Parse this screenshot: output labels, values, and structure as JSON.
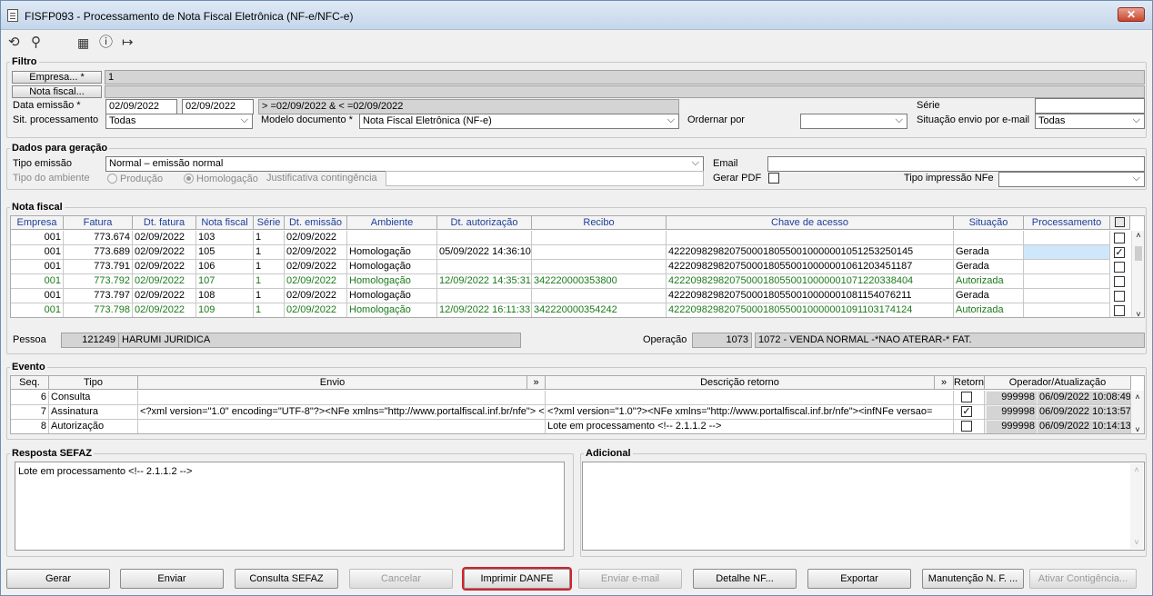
{
  "window": {
    "title": "FISFP093 - Processamento de Nota Fiscal Eletrônica (NF-e/NFC-e)",
    "close": "✕"
  },
  "toolbar": {
    "undo_icon": "undo-icon",
    "search_icon": "search-icon",
    "calendar_icon": "calendar-icon",
    "help_icon": "help-icon",
    "exit_icon": "exit-icon"
  },
  "filtro": {
    "title": "Filtro",
    "empresa_btn": "Empresa... *",
    "empresa_val": "1",
    "nota_btn": "Nota fiscal...",
    "data_lbl": "Data emissão *",
    "data_from": "02/09/2022",
    "data_to": "02/09/2022",
    "data_expr": "> =02/09/2022 & < =02/09/2022",
    "serie_lbl": "Série",
    "serie_val": "",
    "sit_lbl": "Sit. processamento",
    "sit_val": "Todas",
    "modelo_lbl": "Modelo documento *",
    "modelo_val": "Nota Fiscal Eletrônica (NF-e)",
    "ordenar_lbl": "Ordernar por",
    "ordenar_val": "",
    "situacao_email_lbl": "Situação envio por e-mail",
    "situacao_email_val": "Todas"
  },
  "dados": {
    "title": "Dados para geração",
    "tipo_emissao_lbl": "Tipo emissão",
    "tipo_emissao_val": "Normal – emissão normal",
    "email_lbl": "Email",
    "email_val": "",
    "tipo_ambiente_lbl": "Tipo do ambiente",
    "producao": "Produção",
    "homologacao": "Homologação",
    "justificativa_lbl": "Justificativa contingência",
    "justificativa_val": "",
    "gerar_pdf_lbl": "Gerar PDF",
    "tipo_impressao_lbl": "Tipo impressão NFe",
    "tipo_impressao_val": ""
  },
  "nota": {
    "title": "Nota fiscal",
    "headers": [
      "Empresa",
      "Fatura",
      "Dt. fatura",
      "Nota fiscal",
      "Série",
      "Dt. emissão",
      "Ambiente",
      "Dt. autorização",
      "Recibo",
      "Chave de acesso",
      "Situação",
      "Processamento"
    ],
    "rows": [
      {
        "empresa": "001",
        "fatura": "773.674",
        "dt_fatura": "02/09/2022",
        "nota": "103",
        "serie": "1",
        "dt_emissao": "02/09/2022",
        "ambiente": "",
        "dt_aut": "",
        "recibo": "",
        "chave": "",
        "situacao": "",
        "checked": false,
        "green": false
      },
      {
        "empresa": "001",
        "fatura": "773.689",
        "dt_fatura": "02/09/2022",
        "nota": "105",
        "serie": "1",
        "dt_emissao": "02/09/2022",
        "ambiente": "Homologação",
        "dt_aut": "05/09/2022 14:36:10",
        "recibo": "",
        "chave": "42220982982075000180550010000001051253250145",
        "situacao": "Gerada",
        "checked": true,
        "green": false
      },
      {
        "empresa": "001",
        "fatura": "773.791",
        "dt_fatura": "02/09/2022",
        "nota": "106",
        "serie": "1",
        "dt_emissao": "02/09/2022",
        "ambiente": "Homologação",
        "dt_aut": "",
        "recibo": "",
        "chave": "42220982982075000180550010000001061203451187",
        "situacao": "Gerada",
        "checked": false,
        "green": false
      },
      {
        "empresa": "001",
        "fatura": "773.792",
        "dt_fatura": "02/09/2022",
        "nota": "107",
        "serie": "1",
        "dt_emissao": "02/09/2022",
        "ambiente": "Homologação",
        "dt_aut": "12/09/2022 14:35:31",
        "recibo": "342220000353800",
        "chave": "42220982982075000180550010000001071220338404",
        "situacao": "Autorizada",
        "checked": false,
        "green": true
      },
      {
        "empresa": "001",
        "fatura": "773.797",
        "dt_fatura": "02/09/2022",
        "nota": "108",
        "serie": "1",
        "dt_emissao": "02/09/2022",
        "ambiente": "Homologação",
        "dt_aut": "",
        "recibo": "",
        "chave": "42220982982075000180550010000001081154076211",
        "situacao": "Gerada",
        "checked": false,
        "green": false
      },
      {
        "empresa": "001",
        "fatura": "773.798",
        "dt_fatura": "02/09/2022",
        "nota": "109",
        "serie": "1",
        "dt_emissao": "02/09/2022",
        "ambiente": "Homologação",
        "dt_aut": "12/09/2022 16:11:33",
        "recibo": "342220000354242",
        "chave": "42220982982075000180550010000001091103174124",
        "situacao": "Autorizada",
        "checked": false,
        "green": true
      }
    ],
    "pessoa_lbl": "Pessoa",
    "pessoa_cod": "121249",
    "pessoa_nome": "HARUMI JURIDICA",
    "operacao_lbl": "Operação",
    "operacao_cod": "1073",
    "operacao_desc": "1072 - VENDA NORMAL -*NAO ATERAR-* FAT."
  },
  "evento": {
    "title": "Evento",
    "headers": [
      "Seq.",
      "Tipo",
      "Envio",
      "»",
      "Descrição retorno",
      "»",
      "Retorno",
      "Operador/Atualização"
    ],
    "rows": [
      {
        "seq": "6",
        "tipo": "Consulta",
        "envio": "",
        "retorno_desc": "",
        "checked": false,
        "op": "999998",
        "data": "06/09/2022 10:08:49"
      },
      {
        "seq": "7",
        "tipo": "Assinatura",
        "envio": "<?xml version=\"1.0\" encoding=\"UTF-8\"?><NFe xmlns=\"http://www.portalfiscal.inf.br/nfe\"> <infNFe",
        "retorno_desc": "<?xml version=\"1.0\"?><NFe xmlns=\"http://www.portalfiscal.inf.br/nfe\"><infNFe versao=",
        "checked": true,
        "op": "999998",
        "data": "06/09/2022 10:13:57"
      },
      {
        "seq": "8",
        "tipo": "Autorização",
        "envio": "",
        "retorno_desc": "Lote em processamento <!-- 2.1.1.2 -->",
        "checked": false,
        "op": "999998",
        "data": "06/09/2022 10:14:13"
      }
    ]
  },
  "resposta": {
    "title": "Resposta SEFAZ",
    "text": "Lote em processamento <!-- 2.1.1.2 -->"
  },
  "adicional": {
    "title": "Adicional",
    "text": ""
  },
  "buttons": [
    "Gerar",
    "Enviar",
    "Consulta SEFAZ",
    "Cancelar",
    "Imprimir DANFE",
    "Enviar e-mail",
    "Detalhe NF...",
    "Exportar",
    "Manutenção N. F. ...",
    "Ativar Contigência..."
  ]
}
